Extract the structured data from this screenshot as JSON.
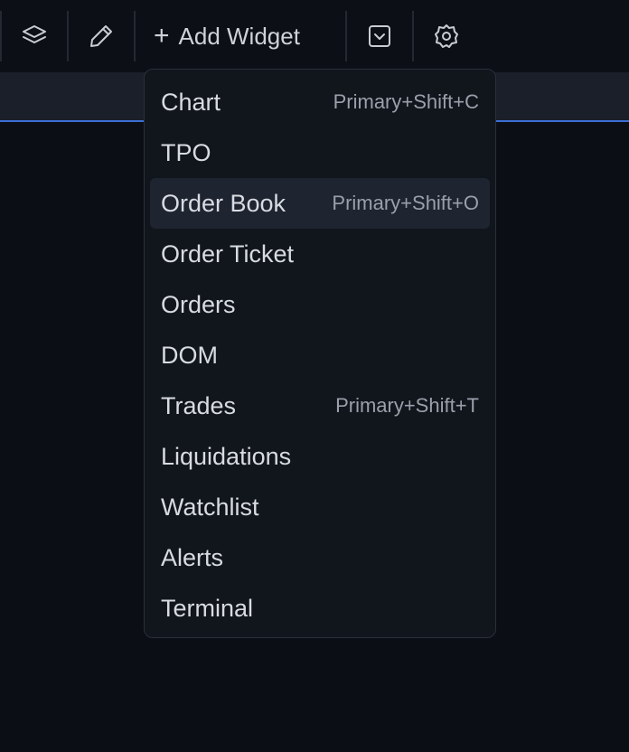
{
  "toolbar": {
    "icons": {
      "layers": "layers-icon",
      "edit": "pencil-icon",
      "collapse": "chevron-down-square-icon",
      "settings": "gear-icon"
    },
    "add_widget_label": "Add Widget",
    "add_widget_icon": "+"
  },
  "menu": {
    "items": [
      {
        "label": "Chart",
        "shortcut": "Primary+Shift+C"
      },
      {
        "label": "TPO",
        "shortcut": ""
      },
      {
        "label": "Order Book",
        "shortcut": "Primary+Shift+O"
      },
      {
        "label": "Order Ticket",
        "shortcut": ""
      },
      {
        "label": "Orders",
        "shortcut": ""
      },
      {
        "label": "DOM",
        "shortcut": ""
      },
      {
        "label": "Trades",
        "shortcut": "Primary+Shift+T"
      },
      {
        "label": "Liquidations",
        "shortcut": ""
      },
      {
        "label": "Watchlist",
        "shortcut": ""
      },
      {
        "label": "Alerts",
        "shortcut": ""
      },
      {
        "label": "Terminal",
        "shortcut": ""
      }
    ],
    "highlighted_index": 2
  },
  "colors": {
    "background": "#0b0e15",
    "menu_background": "#11151c",
    "highlight": "#1e2430",
    "accent_line": "#3b6fd6",
    "text": "#d8dbe2",
    "shortcut_text": "#9aa0ab"
  }
}
